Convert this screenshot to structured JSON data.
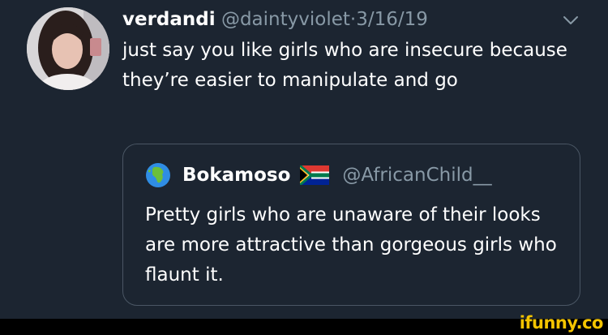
{
  "tweet": {
    "display_name": "verdandi",
    "handle": "@daintyviolet",
    "separator": "·",
    "date": "3/16/19",
    "text": "just say you like girls who are insecure because they’re easier to manipulate and go",
    "avatar_icon": "user-avatar-photo",
    "menu_icon": "chevron-down-icon"
  },
  "quoted_tweet": {
    "display_name": "Bokamoso",
    "handle": "@AfricanChild__",
    "text": "Pretty girls who are unaware of their looks are more attractive than gorgeous girls who flaunt it.",
    "name_prefix_icon": "globe-africa-icon",
    "name_suffix_icon": "south-africa-flag-icon"
  },
  "watermark": {
    "text": "ifunny.co",
    "color": "#f4c400"
  },
  "colors": {
    "background": "#1c2531",
    "primary_text": "#ffffff",
    "secondary_text": "#8899a6",
    "card_border": "#4a5664"
  }
}
